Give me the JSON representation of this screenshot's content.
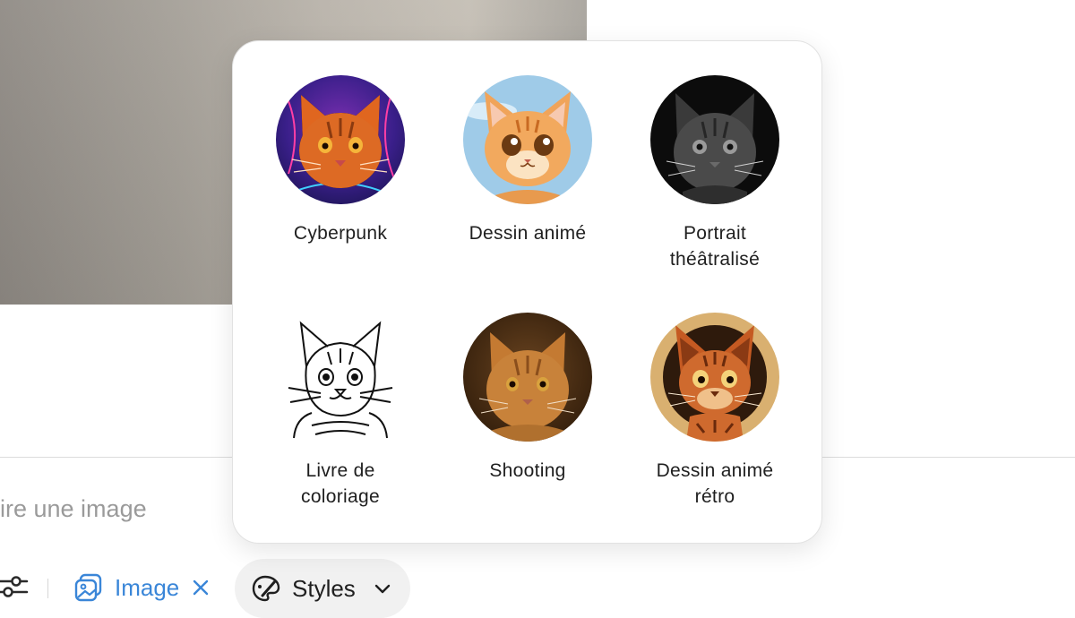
{
  "prompt": {
    "placeholder": "ire une image"
  },
  "toolbar": {
    "settings_icon": "sliders-icon",
    "image_chip": {
      "label": "Image",
      "icon": "image-icon",
      "remove_icon": "close-icon",
      "accent": "#3a86d8"
    },
    "styles_button": {
      "label": "Styles",
      "icon": "paintbrush-icon",
      "chevron_icon": "chevron-down-icon"
    }
  },
  "styles_popover": {
    "options": [
      {
        "label": "Cyberpunk",
        "thumbnail": "cyberpunk-cat-thumbnail"
      },
      {
        "label": "Dessin animé",
        "thumbnail": "cartoon-cat-thumbnail"
      },
      {
        "label": "Portrait\nthéâtralisé",
        "thumbnail": "theatrical-portrait-cat-thumbnail"
      },
      {
        "label": "Livre de\ncoloriage",
        "thumbnail": "coloring-book-cat-thumbnail"
      },
      {
        "label": "Shooting",
        "thumbnail": "photoshoot-cat-thumbnail"
      },
      {
        "label": "Dessin animé\nrétro",
        "thumbnail": "retro-cartoon-cat-thumbnail"
      }
    ]
  }
}
